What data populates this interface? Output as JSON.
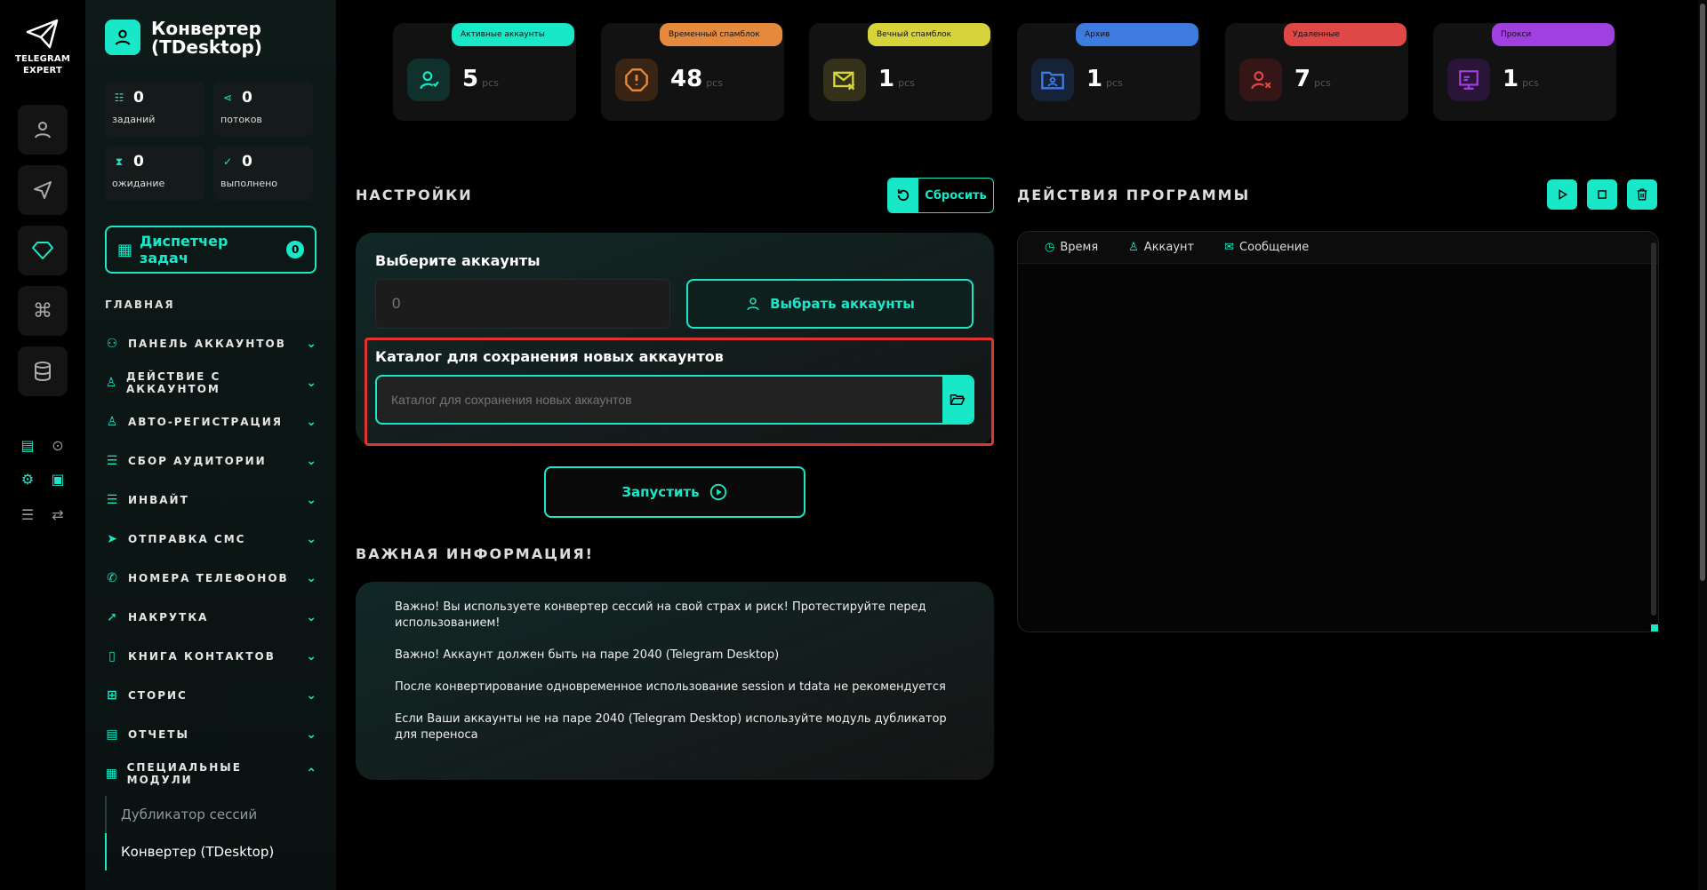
{
  "brand": {
    "line1": "TELEGRAM",
    "line2": "EXPERT"
  },
  "page": {
    "title": "Конвертер (TDesktop)"
  },
  "sidebar_stats": [
    {
      "value": "0",
      "label": "заданий"
    },
    {
      "value": "0",
      "label": "потоков"
    },
    {
      "value": "0",
      "label": "ожидание"
    },
    {
      "value": "0",
      "label": "выполнено"
    }
  ],
  "dispatcher": {
    "label": "Диспетчер задач",
    "count": "0"
  },
  "nav": {
    "section": "ГЛАВНАЯ",
    "items": [
      {
        "label": "ПАНЕЛЬ АККАУНТОВ",
        "icon": "users-icon"
      },
      {
        "label": "ДЕЙСТВИЕ С АККАУНТОМ",
        "icon": "user-icon"
      },
      {
        "label": "АВТО-РЕГИСТРАЦИЯ",
        "icon": "user-plus-icon"
      },
      {
        "label": "СБОР АУДИТОРИИ",
        "icon": "audience-icon"
      },
      {
        "label": "ИНВАЙТ",
        "icon": "invite-icon"
      },
      {
        "label": "ОТПРАВКА СМС",
        "icon": "send-icon"
      },
      {
        "label": "НОМЕРА ТЕЛЕФОНОВ",
        "icon": "phone-icon"
      },
      {
        "label": "НАКРУТКА",
        "icon": "boost-icon"
      },
      {
        "label": "КНИГА КОНТАКТОВ",
        "icon": "contacts-book-icon"
      },
      {
        "label": "СТОРИС",
        "icon": "stories-icon"
      },
      {
        "label": "ОТЧЕТЫ",
        "icon": "reports-icon"
      },
      {
        "label": "СПЕЦИАЛЬНЫЕ МОДУЛИ",
        "icon": "modules-icon"
      }
    ],
    "sub_items": [
      "Дубликатор сессий",
      "Конвертер (TDesktop)"
    ]
  },
  "top_cards": [
    {
      "label": "Активные аккаунты",
      "value": "5",
      "unit": "pcs",
      "color": "#19e8c8",
      "icon": "active-user-icon"
    },
    {
      "label": "Временный спамблок",
      "value": "48",
      "unit": "pcs",
      "color": "#e58a3d",
      "icon": "warning-icon"
    },
    {
      "label": "Вечный спамблок",
      "value": "1",
      "unit": "pcs",
      "color": "#d6d43a",
      "icon": "blocked-mail-icon"
    },
    {
      "label": "Архив",
      "value": "1",
      "unit": "pcs",
      "color": "#3d7be0",
      "icon": "archive-folder-icon"
    },
    {
      "label": "Удаленные",
      "value": "7",
      "unit": "pcs",
      "color": "#e04848",
      "icon": "deleted-user-icon"
    },
    {
      "label": "Прокси",
      "value": "1",
      "unit": "pcs",
      "color": "#a040e0",
      "icon": "proxy-icon"
    }
  ],
  "settings": {
    "title": "НАСТРОЙКИ",
    "reset_label": "Сбросить",
    "accounts_label": "Выберите аккаунты",
    "accounts_value": "0",
    "choose_label": "Выбрать аккаунты",
    "catalog_label": "Каталог для сохранения новых аккаунтов",
    "catalog_placeholder": "Каталог для сохранения новых аккаунтов",
    "run_label": "Запустить"
  },
  "info": {
    "title": "ВАЖНАЯ ИНФОРМАЦИЯ!",
    "lines": [
      "Важно! Вы используете конвертер сессий на свой страх и риск! Протестируйте перед использованием!",
      "Важно! Аккаунт должен быть на паре 2040 (Telegram Desktop)",
      "После конвертирование одновременное использование session и tdata не рекомендуется",
      "Если Ваши аккаунты не на паре 2040 (Telegram Desktop) используйте модуль дубликатор для переноса"
    ]
  },
  "actions": {
    "title": "ДЕЙСТВИЯ ПРОГРАММЫ",
    "columns": [
      "Время",
      "Аккаунт",
      "Сообщение"
    ]
  },
  "colors": {
    "accent": "#19e8c8",
    "highlight": "#e0332e"
  }
}
